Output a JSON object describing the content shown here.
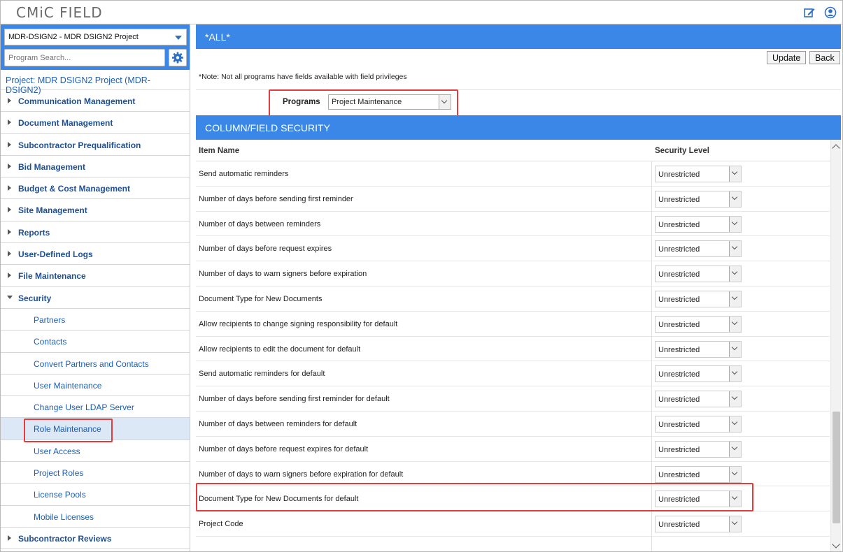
{
  "app": {
    "title": "CMiC FIELD"
  },
  "sidebar": {
    "project_select": "MDR-DSIGN2 - MDR DSIGN2 Project",
    "search_placeholder": "Program Search...",
    "project_label": "Project: MDR DSIGN2 Project (MDR-DSIGN2)",
    "groups": [
      "Communication Management",
      "Document Management",
      "Subcontractor Prequalification",
      "Bid Management",
      "Budget & Cost Management",
      "Site Management",
      "Reports",
      "User-Defined Logs",
      "File Maintenance",
      "Security"
    ],
    "security_items": [
      "Partners",
      "Contacts",
      "Convert Partners and Contacts",
      "User Maintenance",
      "Change User LDAP Server",
      "Role Maintenance",
      "User Access",
      "Project Roles",
      "License Pools",
      "Mobile Licenses"
    ],
    "after_group": "Subcontractor Reviews",
    "active_item": "Role Maintenance"
  },
  "main": {
    "header": "*ALL*",
    "update_label": "Update",
    "back_label": "Back",
    "note": "*Note: Not all programs have fields available with field privileges",
    "programs_label": "Programs",
    "programs_value": "Project Maintenance",
    "section_title": "COLUMN/FIELD SECURITY",
    "col_item": "Item Name",
    "col_level": "Security Level",
    "rows": [
      {
        "name": "Send automatic reminders",
        "level": "Unrestricted"
      },
      {
        "name": "Number of days before sending first reminder",
        "level": "Unrestricted"
      },
      {
        "name": "Number of days between reminders",
        "level": "Unrestricted"
      },
      {
        "name": "Number of days before request expires",
        "level": "Unrestricted"
      },
      {
        "name": "Number of days to warn signers before expiration",
        "level": "Unrestricted"
      },
      {
        "name": "Document Type for New Documents",
        "level": "Unrestricted"
      },
      {
        "name": "Allow recipients to change signing responsibility for default",
        "level": "Unrestricted"
      },
      {
        "name": "Allow recipients to edit the document for default",
        "level": "Unrestricted"
      },
      {
        "name": "Send automatic reminders for default",
        "level": "Unrestricted"
      },
      {
        "name": "Number of days before sending first reminder for default",
        "level": "Unrestricted"
      },
      {
        "name": "Number of days between reminders for default",
        "level": "Unrestricted"
      },
      {
        "name": "Number of days before request expires for default",
        "level": "Unrestricted"
      },
      {
        "name": "Number of days to warn signers before expiration for default",
        "level": "Unrestricted"
      },
      {
        "name": "Document Type for New Documents for default",
        "level": "Unrestricted"
      },
      {
        "name": "Project Code",
        "level": "Unrestricted"
      }
    ]
  },
  "colors": {
    "accent": "#3a87e8",
    "link": "#1d5fb4",
    "highlight": "#e43c3c"
  },
  "icons": [
    "edit-icon",
    "user-icon",
    "gear-icon",
    "caret-down-icon",
    "chevron-down-icon",
    "triangle-right-icon"
  ]
}
